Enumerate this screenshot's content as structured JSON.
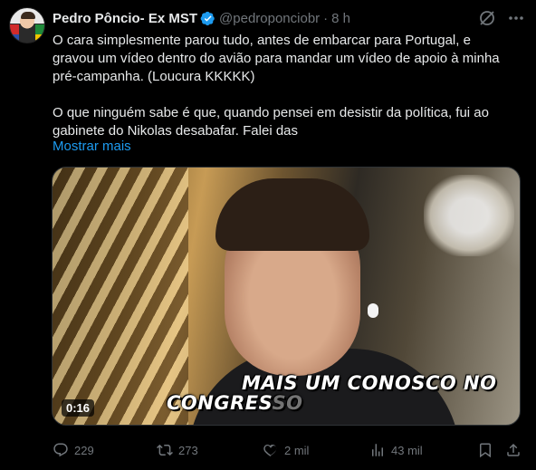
{
  "tweet": {
    "author": {
      "name": "Pedro Pôncio- Ex MST",
      "handle": "@pedroponciobr",
      "time": "8 h",
      "separator": "·"
    },
    "text_lines": [
      "O cara simplesmente parou tudo, antes de embarcar para Portugal, e",
      "gravou um vídeo dentro do avião para mandar um vídeo de apoio à minha",
      "pré-campanha. (Loucura KKKKK)",
      "O que ninguém sabe é que, quando pensei em desistir da política, fui ao",
      "gabinete do Nikolas desabafar. Falei das"
    ],
    "show_more": "Mostrar mais",
    "video": {
      "caption_line1": "MAIS UM CONOSCO NO",
      "caption_line2_visible": "CONGRES",
      "caption_line2_faded": "SO",
      "duration": "0:16"
    },
    "actions": {
      "replies": "229",
      "retweets": "273",
      "likes": "2 mil",
      "views": "43 mil"
    },
    "colors": {
      "accent": "#1d9bf0",
      "muted": "#71767b",
      "text": "#e7e9ea",
      "background": "#000000"
    },
    "icons": [
      "verified-badge-icon",
      "grok-icon",
      "more-icon",
      "reply-icon",
      "retweet-icon",
      "like-icon",
      "views-icon",
      "bookmark-icon",
      "share-icon"
    ]
  }
}
